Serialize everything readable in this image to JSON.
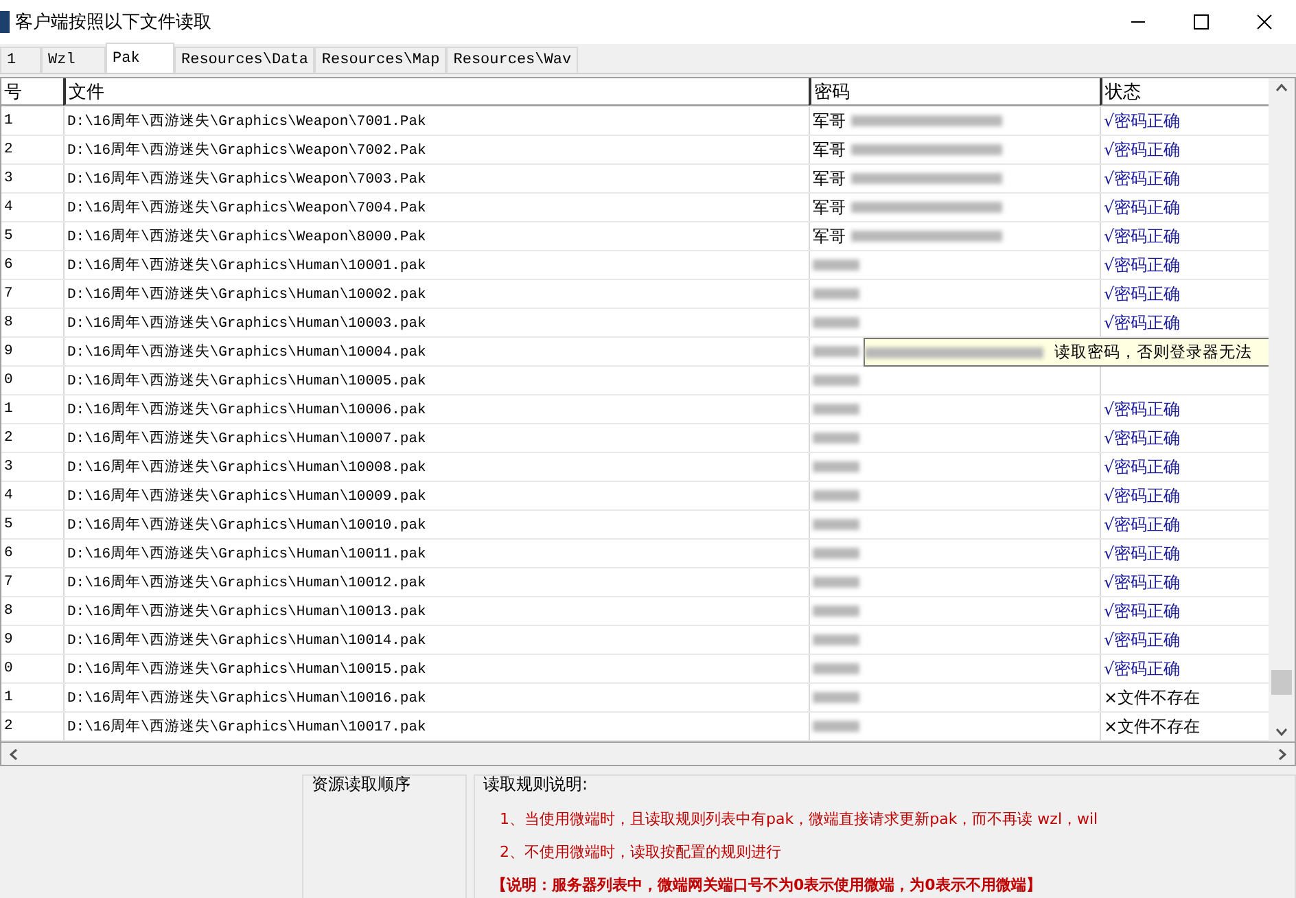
{
  "window": {
    "title": "客户端按照以下文件读取"
  },
  "tabs": [
    {
      "label": "1",
      "selected": false
    },
    {
      "label": "Wzl",
      "selected": false
    },
    {
      "label": "Pak",
      "selected": true
    },
    {
      "label": "Resources\\Data",
      "selected": false
    },
    {
      "label": "Resources\\Map",
      "selected": false
    },
    {
      "label": "Resources\\Wav",
      "selected": false
    }
  ],
  "table": {
    "columns": [
      "号",
      "文件",
      "密码",
      "状态"
    ],
    "rows": [
      {
        "number": "1",
        "file": "D:\\16周年\\西游迷失\\Graphics\\Weapon\\7001.Pak",
        "password": "军哥",
        "status": {
          "kind": "ok",
          "text": "√密码正确"
        }
      },
      {
        "number": "2",
        "file": "D:\\16周年\\西游迷失\\Graphics\\Weapon\\7002.Pak",
        "password": "军哥",
        "status": {
          "kind": "ok",
          "text": "√密码正确"
        }
      },
      {
        "number": "3",
        "file": "D:\\16周年\\西游迷失\\Graphics\\Weapon\\7003.Pak",
        "password": "军哥",
        "status": {
          "kind": "ok",
          "text": "√密码正确"
        }
      },
      {
        "number": "4",
        "file": "D:\\16周年\\西游迷失\\Graphics\\Weapon\\7004.Pak",
        "password": "军哥",
        "status": {
          "kind": "ok",
          "text": "√密码正确"
        }
      },
      {
        "number": "5",
        "file": "D:\\16周年\\西游迷失\\Graphics\\Weapon\\8000.Pak",
        "password": "军哥",
        "status": {
          "kind": "ok",
          "text": "√密码正确"
        }
      },
      {
        "number": "6",
        "file": "D:\\16周年\\西游迷失\\Graphics\\Human\\10001.pak",
        "status": {
          "kind": "ok",
          "text": "√密码正确"
        }
      },
      {
        "number": "7",
        "file": "D:\\16周年\\西游迷失\\Graphics\\Human\\10002.pak",
        "status": {
          "kind": "ok",
          "text": "√密码正确"
        }
      },
      {
        "number": "8",
        "file": "D:\\16周年\\西游迷失\\Graphics\\Human\\10003.pak",
        "status": {
          "kind": "ok",
          "text": "√密码正确"
        }
      },
      {
        "number": "9",
        "file": "D:\\16周年\\西游迷失\\Graphics\\Human\\10004.pak"
      },
      {
        "number": "0",
        "file": "D:\\16周年\\西游迷失\\Graphics\\Human\\10005.pak"
      },
      {
        "number": "1",
        "file": "D:\\16周年\\西游迷失\\Graphics\\Human\\10006.pak",
        "status": {
          "kind": "ok",
          "text": "√密码正确"
        }
      },
      {
        "number": "2",
        "file": "D:\\16周年\\西游迷失\\Graphics\\Human\\10007.pak",
        "status": {
          "kind": "ok",
          "text": "√密码正确"
        }
      },
      {
        "number": "3",
        "file": "D:\\16周年\\西游迷失\\Graphics\\Human\\10008.pak",
        "status": {
          "kind": "ok",
          "text": "√密码正确"
        }
      },
      {
        "number": "4",
        "file": "D:\\16周年\\西游迷失\\Graphics\\Human\\10009.pak",
        "status": {
          "kind": "ok",
          "text": "√密码正确"
        }
      },
      {
        "number": "5",
        "file": "D:\\16周年\\西游迷失\\Graphics\\Human\\10010.pak",
        "status": {
          "kind": "ok",
          "text": "√密码正确"
        }
      },
      {
        "number": "6",
        "file": "D:\\16周年\\西游迷失\\Graphics\\Human\\10011.pak",
        "status": {
          "kind": "ok",
          "text": "√密码正确"
        }
      },
      {
        "number": "7",
        "file": "D:\\16周年\\西游迷失\\Graphics\\Human\\10012.pak",
        "status": {
          "kind": "ok",
          "text": "√密码正确"
        }
      },
      {
        "number": "8",
        "file": "D:\\16周年\\西游迷失\\Graphics\\Human\\10013.pak",
        "status": {
          "kind": "ok",
          "text": "√密码正确"
        }
      },
      {
        "number": "9",
        "file": "D:\\16周年\\西游迷失\\Graphics\\Human\\10014.pak",
        "status": {
          "kind": "ok",
          "text": "√密码正确"
        }
      },
      {
        "number": "0",
        "file": "D:\\16周年\\西游迷失\\Graphics\\Human\\10015.pak",
        "status": {
          "kind": "ok",
          "text": "√密码正确"
        }
      },
      {
        "number": "1",
        "file": "D:\\16周年\\西游迷失\\Graphics\\Human\\10016.pak",
        "status": {
          "kind": "missing",
          "text": "×文件不存在"
        }
      },
      {
        "number": "2",
        "file": "D:\\16周年\\西游迷失\\Graphics\\Human\\10017.pak",
        "status": {
          "kind": "missing",
          "text": "×文件不存在"
        }
      }
    ]
  },
  "tooltip": {
    "text": "读取密码，否则登录器无法"
  },
  "order_group": {
    "title": "资源读取顺序"
  },
  "rules_group": {
    "title": "读取规则说明:",
    "lines": [
      {
        "kind": "rule",
        "text": "1、当使用微端时，且读取规则列表中有pak，微端直接请求更新pak，而不再读 wzl，wil"
      },
      {
        "kind": "rule",
        "text": "2、不使用微端时，读取按配置的规则进行"
      },
      {
        "kind": "note",
        "text": "【说明：服务器列表中，微端网关端口号不为0表示使用微端，为0表示不用微端】"
      }
    ]
  }
}
